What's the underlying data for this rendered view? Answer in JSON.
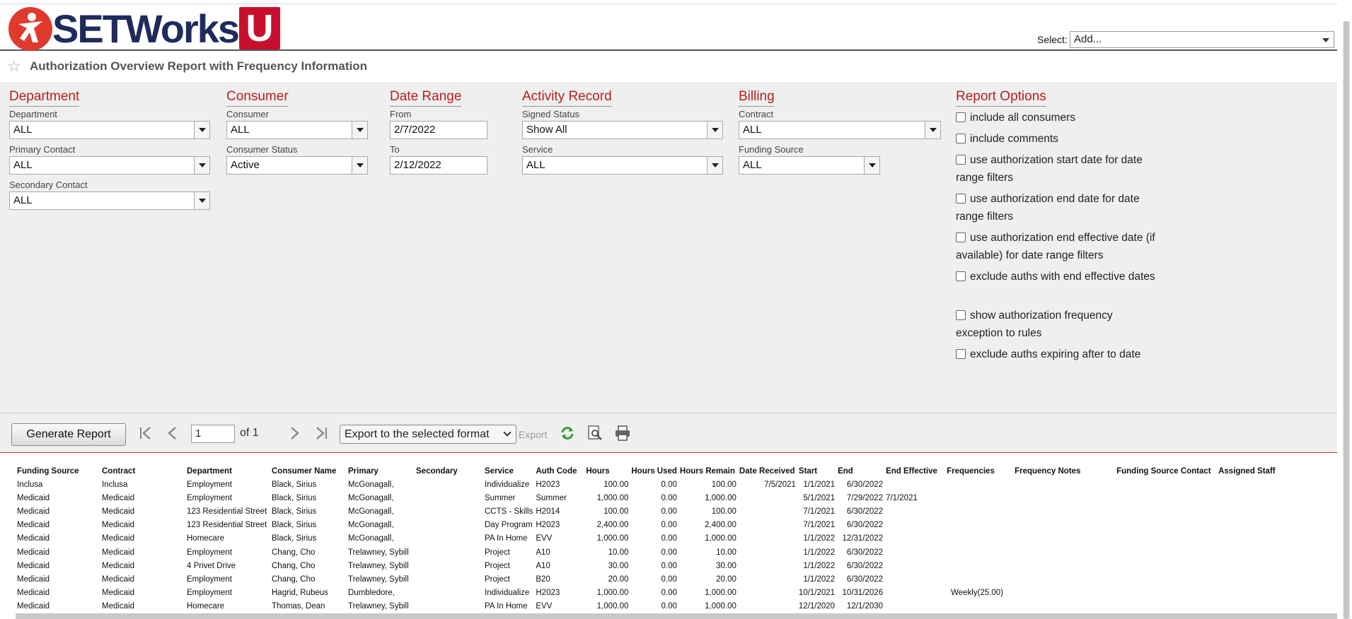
{
  "header": {
    "brand": "SETWorks",
    "brand_u": "U",
    "select_label": "Select:",
    "select_value": "Add..."
  },
  "page_title": "Authorization Overview Report with Frequency Information",
  "filters": {
    "department": {
      "heading": "Department",
      "dept_label": "Department",
      "dept_value": "ALL",
      "primary_label": "Primary Contact",
      "primary_value": "ALL",
      "secondary_label": "Secondary Contact",
      "secondary_value": "ALL"
    },
    "consumer": {
      "heading": "Consumer",
      "consumer_label": "Consumer",
      "consumer_value": "ALL",
      "status_label": "Consumer Status",
      "status_value": "Active"
    },
    "date_range": {
      "heading": "Date Range",
      "from_label": "From",
      "from_value": "2/7/2022",
      "to_label": "To",
      "to_value": "2/12/2022"
    },
    "activity": {
      "heading": "Activity Record",
      "signed_label": "Signed Status",
      "signed_value": "Show All",
      "service_label": "Service",
      "service_value": "ALL"
    },
    "billing": {
      "heading": "Billing",
      "contract_label": "Contract",
      "contract_value": "ALL",
      "funding_label": "Funding Source",
      "funding_value": "ALL"
    },
    "report_options": {
      "heading": "Report Options",
      "options": [
        "include all consumers",
        "include comments",
        "use authorization start date for date range filters",
        "use authorization end date for date range filters",
        "use authorization end effective date (if available) for date range filters",
        "exclude auths with end effective dates",
        "show authorization frequency exception to rules",
        "exclude auths expiring after to date"
      ]
    }
  },
  "toolbar": {
    "generate_label": "Generate Report",
    "page_value": "1",
    "of_label": "of 1",
    "export_format": "Export to the selected format",
    "export_label": "Export"
  },
  "icons": {
    "first": "first-page-icon",
    "prev": "prev-page-icon",
    "next": "next-page-icon",
    "last": "last-page-icon",
    "refresh": "refresh-icon",
    "preview": "print-preview-icon",
    "print": "print-icon",
    "favorite": "star-icon"
  },
  "colors": {
    "accent": "#b81d1d",
    "brand_navy": "#1f2b5b",
    "brand_red": "#c8102e"
  },
  "table": {
    "columns": [
      "Funding Source",
      "Contract",
      "Department",
      "Consumer Name",
      "Primary",
      "Secondary",
      "Service",
      "Auth Code",
      "Hours",
      "Hours Used",
      "Hours Remain",
      "Date Received",
      "Start",
      "End",
      "End Effective",
      "Frequencies",
      "Frequency Notes",
      "Funding Source Contact",
      "Assigned Staff"
    ],
    "rows": [
      [
        "Inclusa",
        "Inclusa",
        "Employment",
        "Black, Sirius",
        "McGonagall,",
        "",
        "Individualize",
        "H2023",
        "100.00",
        "0.00",
        "100.00",
        "7/5/2021",
        "1/1/2021",
        "6/30/2022",
        "",
        "",
        "",
        "",
        ""
      ],
      [
        "Medicaid",
        "Medicaid",
        "Employment",
        "Black, Sirius",
        "McGonagall,",
        "",
        "Summer",
        "Summer",
        "1,000.00",
        "0.00",
        "1,000.00",
        "",
        "5/1/2021",
        "7/29/2022",
        "7/1/2021",
        "",
        "",
        "",
        ""
      ],
      [
        "Medicaid",
        "Medicaid",
        "123 Residential Street",
        "Black, Sirius",
        "McGonagall,",
        "",
        "CCTS - Skills",
        "H2014",
        "100.00",
        "0.00",
        "100.00",
        "",
        "7/1/2021",
        "6/30/2022",
        "",
        "",
        "",
        "",
        ""
      ],
      [
        "Medicaid",
        "Medicaid",
        "123 Residential Street",
        "Black, Sirius",
        "McGonagall,",
        "",
        "Day Program",
        "H2023",
        "2,400.00",
        "0.00",
        "2,400.00",
        "",
        "7/1/2021",
        "6/30/2022",
        "",
        "",
        "",
        "",
        ""
      ],
      [
        "Medicaid",
        "Medicaid",
        "Homecare",
        "Black, Sirius",
        "McGonagall,",
        "",
        "PA In Home",
        "EVV",
        "1,000.00",
        "0.00",
        "1,000.00",
        "",
        "1/1/2022",
        "12/31/2022",
        "",
        "",
        "",
        "",
        ""
      ],
      [
        "Medicaid",
        "Medicaid",
        "Employment",
        "Chang, Cho",
        "Trelawney, Sybill",
        "",
        "Project",
        "A10",
        "10.00",
        "0.00",
        "10.00",
        "",
        "1/1/2022",
        "6/30/2022",
        "",
        "",
        "",
        "",
        ""
      ],
      [
        "Medicaid",
        "Medicaid",
        "4 Privet Drive",
        "Chang, Cho",
        "Trelawney, Sybill",
        "",
        "Project",
        "A10",
        "30.00",
        "0.00",
        "30.00",
        "",
        "1/1/2022",
        "6/30/2022",
        "",
        "",
        "",
        "",
        ""
      ],
      [
        "Medicaid",
        "Medicaid",
        "Employment",
        "Chang, Cho",
        "Trelawney, Sybill",
        "",
        "Project",
        "B20",
        "20.00",
        "0.00",
        "20.00",
        "",
        "1/1/2022",
        "6/30/2022",
        "",
        "",
        "",
        "",
        ""
      ],
      [
        "Medicaid",
        "Medicaid",
        "Employment",
        "Hagrid, Rubeus",
        "Dumbledore,",
        "",
        "Individualize",
        "H2023",
        "1,000.00",
        "0.00",
        "1,000.00",
        "",
        "10/1/2021",
        "10/31/2026",
        "",
        "Weekly(25.00)",
        "",
        "",
        ""
      ],
      [
        "Medicaid",
        "Medicaid",
        "Homecare",
        "Thomas, Dean",
        "Trelawney, Sybill",
        "",
        "PA In Home",
        "EVV",
        "1,000.00",
        "0.00",
        "1,000.00",
        "",
        "12/1/2020",
        "12/1/2030",
        "",
        "",
        "",
        "",
        ""
      ]
    ]
  }
}
